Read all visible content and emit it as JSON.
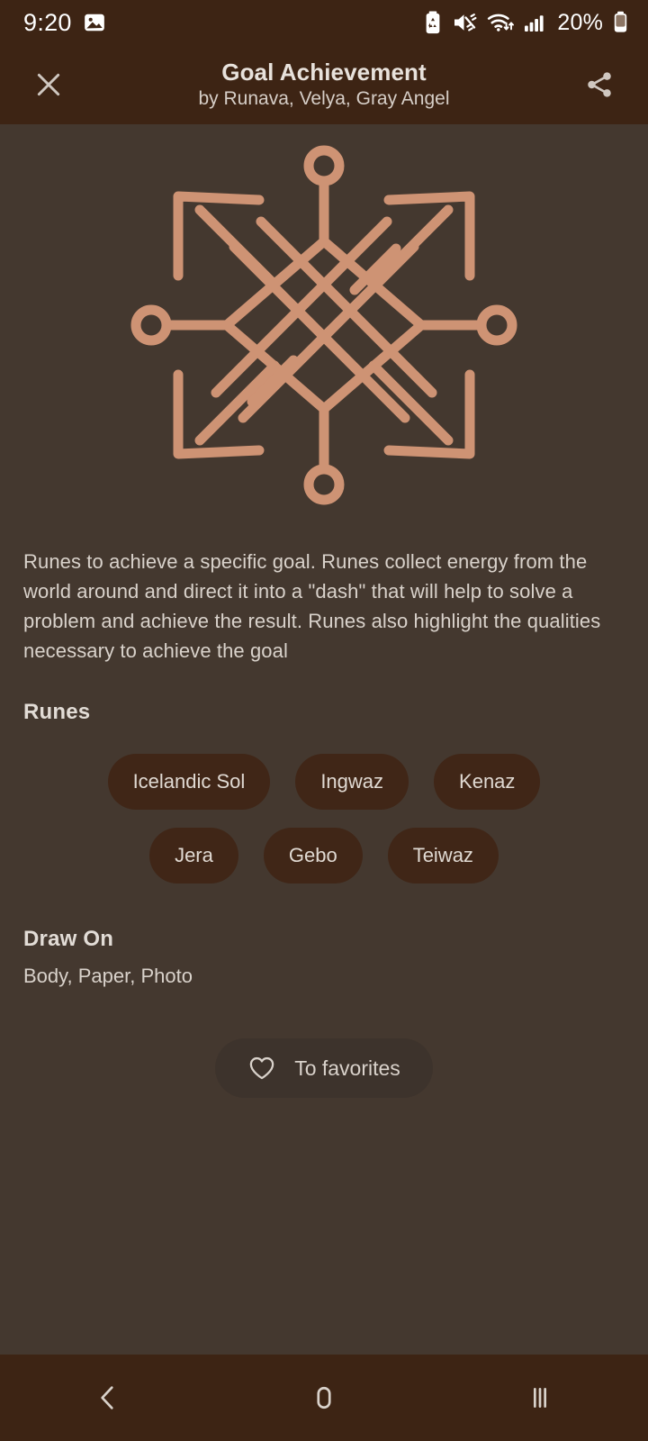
{
  "statusbar": {
    "time": "9:20",
    "battery_percent": "20%",
    "icons": [
      "image-icon",
      "battery-saver-icon",
      "mute-icon",
      "wifi-icon",
      "signal-icon",
      "battery-icon"
    ]
  },
  "header": {
    "title": "Goal Achievement",
    "subtitle": "by Runava, Velya, Gray Angel",
    "close_icon": "close-icon",
    "share_icon": "share-icon"
  },
  "sigil": {
    "name": "rune-sigil-goal-achievement",
    "color": "#CE9374",
    "background": "#44382F"
  },
  "main": {
    "description": "Runes to achieve a specific goal. Runes collect energy from the world around and direct it into a \"dash\" that will help to solve a problem and achieve the result. Runes also highlight the qualities necessary to achieve the goal",
    "runes_title": "Runes",
    "runes": [
      "Icelandic Sol",
      "Ingwaz",
      "Kenaz",
      "Jera",
      "Gebo",
      "Teiwaz"
    ],
    "draw_on_title": "Draw On",
    "draw_on_value": "Body, Paper, Photo",
    "favorites_label": "To favorites",
    "favorites_icon": "heart-outline-icon"
  },
  "navbar": {
    "back_icon": "back-chevron-icon",
    "home_icon": "home-icon",
    "recents_icon": "recents-icon"
  },
  "colors": {
    "header_bg": "#3D2414",
    "body_bg": "#44382F",
    "chip_bg": "#402617",
    "accent": "#CE9374",
    "text_primary": "#E2DCD6",
    "text_secondary": "#D9D2CB"
  }
}
